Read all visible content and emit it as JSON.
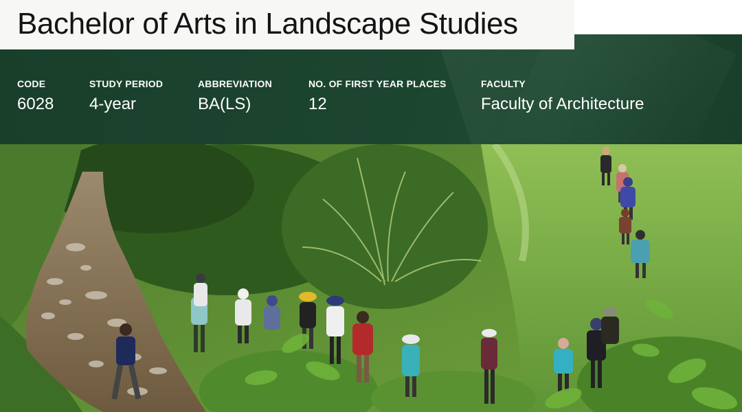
{
  "programme": {
    "title": "Bachelor of Arts in Landscape Studies"
  },
  "facts": {
    "code": {
      "label": "CODE",
      "value": "6028"
    },
    "study_period": {
      "label": "STUDY PERIOD",
      "value": "4-year"
    },
    "abbreviation": {
      "label": "ABBREVIATION",
      "value": "BA(LS)"
    },
    "first_year_places": {
      "label": "NO. OF FIRST YEAR PLACES",
      "value": "12"
    },
    "faculty": {
      "label": "FACULTY",
      "value": "Faculty of Architecture"
    }
  },
  "colors": {
    "band_green": "#1c4530",
    "title_bg": "#f7f7f5",
    "title_text": "#141414"
  }
}
